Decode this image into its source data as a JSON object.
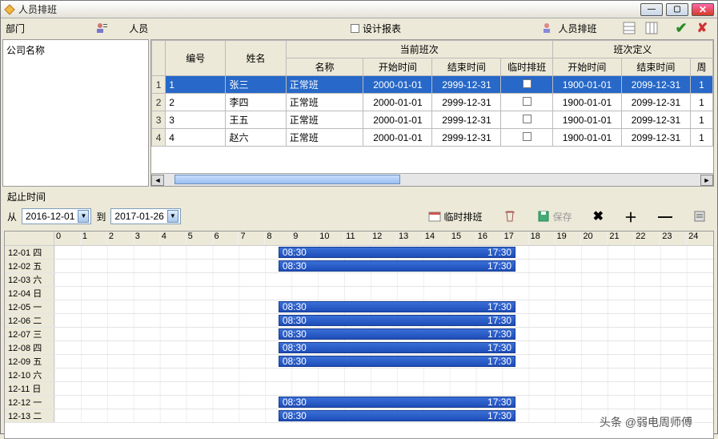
{
  "window": {
    "title": "人员排班"
  },
  "dept": {
    "label": "部门",
    "root": "公司名称"
  },
  "personnel": {
    "label": "人员"
  },
  "topToolbar": {
    "designReport": "设计报表",
    "personSchedule": "人员排班"
  },
  "grid": {
    "headers": {
      "number": "编号",
      "name": "姓名",
      "currentShift": "当前班次",
      "shiftDef": "班次定义",
      "shiftName": "名称",
      "startTime": "开始时间",
      "endTime": "结束时间",
      "tempSched": "临时排班",
      "defStart": "开始时间",
      "defEnd": "结束时间",
      "cycle": "周"
    },
    "rows": [
      {
        "idx": "1",
        "num": "1",
        "name": "张三",
        "shift": "正常班",
        "start": "2000-01-01",
        "end": "2999-12-31",
        "dstart": "1900-01-01",
        "dend": "2099-12-31",
        "c": "1"
      },
      {
        "idx": "2",
        "num": "2",
        "name": "李四",
        "shift": "正常班",
        "start": "2000-01-01",
        "end": "2999-12-31",
        "dstart": "1900-01-01",
        "dend": "2099-12-31",
        "c": "1"
      },
      {
        "idx": "3",
        "num": "3",
        "name": "王五",
        "shift": "正常班",
        "start": "2000-01-01",
        "end": "2999-12-31",
        "dstart": "1900-01-01",
        "dend": "2099-12-31",
        "c": "1"
      },
      {
        "idx": "4",
        "num": "4",
        "name": "赵六",
        "shift": "正常班",
        "start": "2000-01-01",
        "end": "2999-12-31",
        "dstart": "1900-01-01",
        "dend": "2099-12-31",
        "c": "1"
      }
    ]
  },
  "timeRange": {
    "label": "起止时间",
    "from": "从",
    "to": "到",
    "dateFrom": "2016-12-01",
    "dateTo": "2017-01-26"
  },
  "midToolbar": {
    "tempSched": "临时排班",
    "save": "保存"
  },
  "schedule": {
    "hours": [
      "0",
      "1",
      "2",
      "3",
      "4",
      "5",
      "6",
      "7",
      "8",
      "9",
      "10",
      "11",
      "12",
      "13",
      "14",
      "15",
      "16",
      "17",
      "18",
      "19",
      "20",
      "21",
      "22",
      "23",
      "24"
    ],
    "barStart": "08:30",
    "barEnd": "17:30",
    "days": [
      {
        "date": "12-01",
        "dow": "四",
        "bar": true
      },
      {
        "date": "12-02",
        "dow": "五",
        "bar": true
      },
      {
        "date": "12-03",
        "dow": "六",
        "bar": false
      },
      {
        "date": "12-04",
        "dow": "日",
        "bar": false
      },
      {
        "date": "12-05",
        "dow": "一",
        "bar": true
      },
      {
        "date": "12-06",
        "dow": "二",
        "bar": true
      },
      {
        "date": "12-07",
        "dow": "三",
        "bar": true
      },
      {
        "date": "12-08",
        "dow": "四",
        "bar": true
      },
      {
        "date": "12-09",
        "dow": "五",
        "bar": true
      },
      {
        "date": "12-10",
        "dow": "六",
        "bar": false
      },
      {
        "date": "12-11",
        "dow": "日",
        "bar": false
      },
      {
        "date": "12-12",
        "dow": "一",
        "bar": true
      },
      {
        "date": "12-13",
        "dow": "二",
        "bar": true
      }
    ]
  },
  "watermark": "头条 @弱电周师傅"
}
